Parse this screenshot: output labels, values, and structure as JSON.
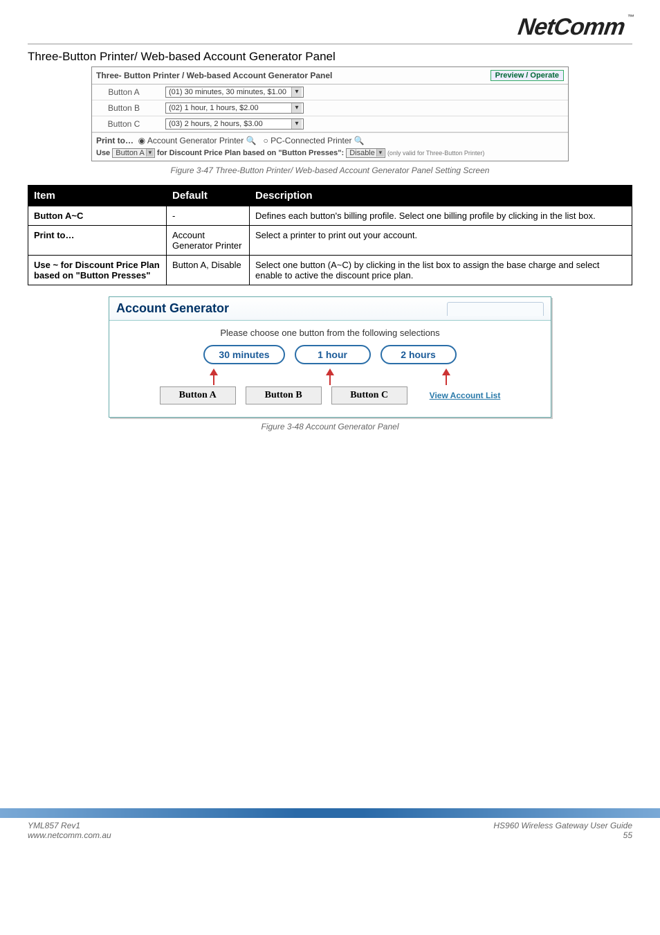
{
  "logo": {
    "text": "NetComm",
    "tm": "™"
  },
  "section_title": "Three-Button Printer/ Web-based Account Generator Panel",
  "config_panel": {
    "title": "Three- Button Printer / Web-based Account Generator Panel",
    "preview_btn": "Preview / Operate",
    "rows": [
      {
        "label": "Button A",
        "value": "(01) 30 minutes, 30 minutes, $1.00"
      },
      {
        "label": "Button B",
        "value": "(02) 1 hour, 1 hours, $2.00"
      },
      {
        "label": "Button C",
        "value": "(03) 2 hours, 2 hours, $3.00"
      }
    ],
    "print_to_label": "Print to…",
    "print_to_opt1": "Account Generator Printer",
    "print_to_opt2": "PC-Connected Printer",
    "use_prefix": "Use",
    "use_select": "Button A",
    "use_mid": "for Discount Price Plan based on \"Button Presses\":",
    "disable_select": "Disable",
    "fine_print": "(only valid for Three-Button Printer)"
  },
  "fig1_caption": "Figure 3-47 Three-Button Printer/ Web-based Account Generator Panel Setting Screen",
  "table": {
    "headers": {
      "item": "Item",
      "default": "Default",
      "description": "Description"
    },
    "rows": [
      {
        "item": "Button A~C",
        "default": "-",
        "description": "Defines each button's billing profile. Select one billing profile by clicking in the list box."
      },
      {
        "item": "Print to…",
        "default": "Account Generator Printer",
        "description": "Select a printer to print out your account."
      },
      {
        "item": "Use ~ for Discount Price Plan based on \"Button Presses\"",
        "default": "Button A, Disable",
        "description": "Select one button (A~C) by clicking in the list box to assign the base charge and select enable to active the discount price plan."
      }
    ]
  },
  "acct": {
    "title": "Account Generator",
    "instruction": "Please choose one button from the following selections",
    "pills": [
      "30 minutes",
      "1 hour",
      "2 hours"
    ],
    "buttons": [
      "Button A",
      "Button B",
      "Button C"
    ],
    "view_link": "View Account List"
  },
  "fig2_caption": "Figure 3-48 Account Generator Panel",
  "footer": {
    "left_line1": "YML857 Rev1",
    "left_line2": "www.netcomm.com.au",
    "right_line1": "HS960 Wireless Gateway User Guide",
    "right_line2": "55"
  }
}
